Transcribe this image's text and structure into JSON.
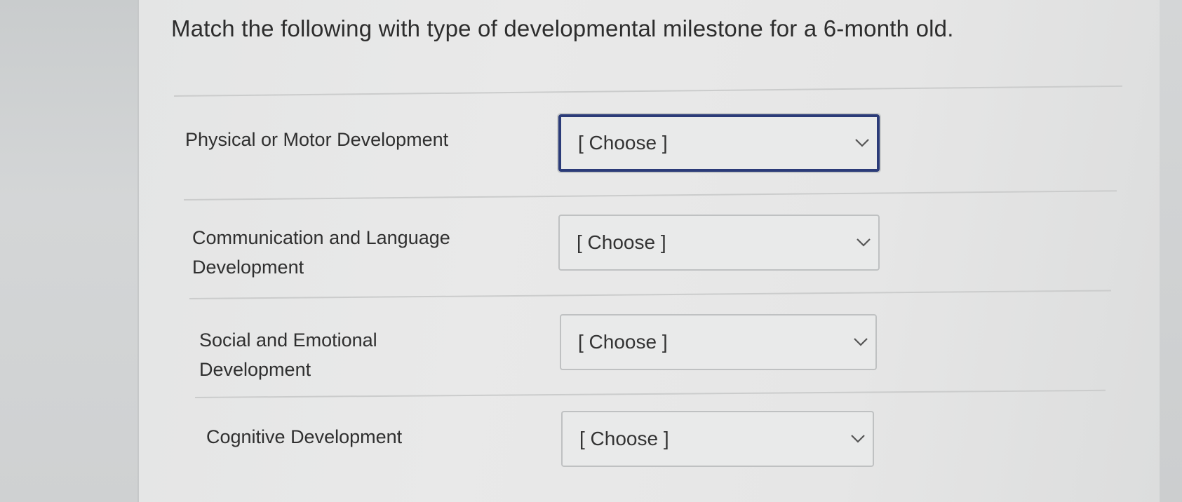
{
  "question": "Match the following with type of developmental milestone for a 6-month old.",
  "rows": [
    {
      "label": "Physical or Motor Development",
      "selected": "[ Choose ]"
    },
    {
      "label": "Communication and Language Development",
      "selected": "[ Choose ]"
    },
    {
      "label": "Social and Emotional Development",
      "selected": "[ Choose ]"
    },
    {
      "label": "Cognitive Development",
      "selected": "[ Choose ]"
    }
  ],
  "icons": {
    "dropdown": "chevron-down-icon"
  },
  "colors": {
    "focus_border": "#2b3b78",
    "select_border": "#bfc1c2",
    "text": "#2f2f2f"
  }
}
